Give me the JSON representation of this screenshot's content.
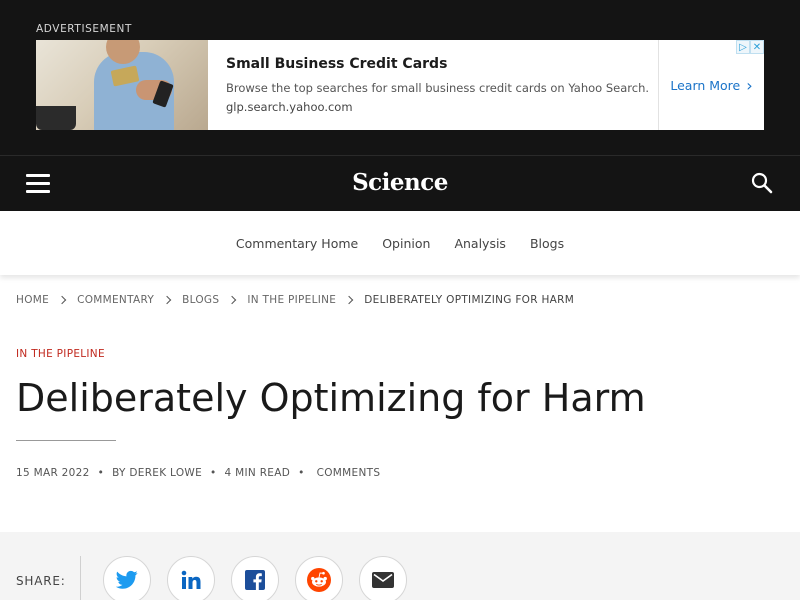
{
  "ad": {
    "label": "ADVERTISEMENT",
    "title": "Small Business Credit Cards",
    "description": "Browse the top searches for small business credit cards on Yahoo Search.",
    "url": "glp.search.yahoo.com",
    "cta": "Learn More",
    "cta_color": "#1a73c8"
  },
  "header": {
    "brand": "Science",
    "menu_icon": "hamburger-menu-icon",
    "search_icon": "search-icon",
    "background": "#141414"
  },
  "subnav": {
    "items": [
      {
        "label": "Commentary Home"
      },
      {
        "label": "Opinion"
      },
      {
        "label": "Analysis"
      },
      {
        "label": "Blogs"
      }
    ]
  },
  "breadcrumb": {
    "items": [
      {
        "label": "HOME"
      },
      {
        "label": "COMMENTARY"
      },
      {
        "label": "BLOGS"
      },
      {
        "label": "IN THE PIPELINE"
      },
      {
        "label": "DELIBERATELY OPTIMIZING FOR HARM"
      }
    ]
  },
  "article": {
    "kicker": "IN THE PIPELINE",
    "kicker_color": "#c0281e",
    "title": "Deliberately Optimizing for Harm",
    "date": "15 MAR 2022",
    "separator": "•",
    "author": "BY DEREK LOWE",
    "read_time": "4 MIN READ",
    "comments": "COMMENTS"
  },
  "share": {
    "label": "SHARE:",
    "buttons": [
      {
        "icon": "twitter-icon",
        "color": "#1d9bf0"
      },
      {
        "icon": "linkedin-icon",
        "color": "#0a66c2"
      },
      {
        "icon": "facebook-icon",
        "color": "#1877f2"
      },
      {
        "icon": "reddit-icon",
        "color": "#ff4500"
      },
      {
        "icon": "email-icon",
        "color": "#333333"
      }
    ]
  }
}
